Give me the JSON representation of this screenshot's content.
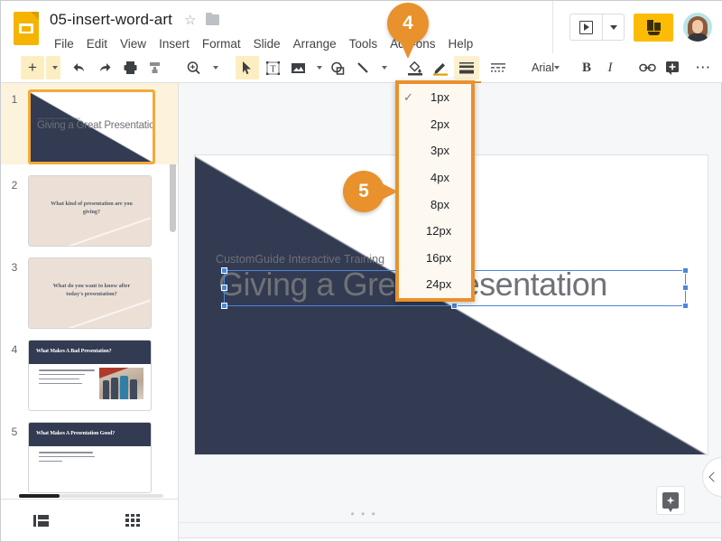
{
  "header": {
    "doc_title": "05-insert-word-art",
    "logo_icon": "google-slides-logo",
    "star_icon": "star-outline-icon",
    "folder_icon": "move-to-folder-icon",
    "menus": [
      "File",
      "Edit",
      "View",
      "Insert",
      "Format",
      "Slide",
      "Arrange",
      "Tools",
      "Add-ons",
      "Help"
    ],
    "present_label": "present-icon",
    "present_caret": "chevron-down-icon",
    "share_label": "share-icon",
    "avatar_label": "user-avatar"
  },
  "toolbar": {
    "items": [
      {
        "name": "new-slide-button",
        "icon": "plus-icon"
      },
      {
        "name": "new-slide-caret",
        "icon": "chevron-down-icon"
      },
      {
        "name": "undo-button",
        "icon": "undo-icon"
      },
      {
        "name": "redo-button",
        "icon": "redo-icon"
      },
      {
        "name": "print-button",
        "icon": "printer-icon"
      },
      {
        "name": "paint-format-button",
        "icon": "paint-roller-icon"
      },
      {
        "name": "zoom-button",
        "icon": "magnifier-icon"
      },
      {
        "name": "zoom-caret",
        "icon": "chevron-down-icon"
      },
      {
        "name": "select-tool",
        "icon": "cursor-arrow-icon"
      },
      {
        "name": "text-box-tool",
        "icon": "text-box-icon"
      },
      {
        "name": "image-tool",
        "icon": "image-icon"
      },
      {
        "name": "shape-tool",
        "icon": "shape-icon"
      },
      {
        "name": "line-tool",
        "icon": "line-icon"
      },
      {
        "name": "fill-color-button",
        "icon": "paint-bucket-icon"
      },
      {
        "name": "border-color-button",
        "icon": "pencil-icon"
      },
      {
        "name": "border-weight-button",
        "icon": "border-weight-icon"
      },
      {
        "name": "border-dash-button",
        "icon": "border-dash-icon"
      }
    ],
    "font_name": "Arial",
    "bold_label": "B",
    "italic_label": "I",
    "link_icon": "link-icon",
    "comment_icon": "add-comment-icon",
    "more_label": "⋯",
    "collapse_icon": "chevron-up-icon"
  },
  "border_weight_menu": {
    "options": [
      {
        "label": "1px",
        "checked": true
      },
      {
        "label": "2px",
        "checked": false
      },
      {
        "label": "3px",
        "checked": false
      },
      {
        "label": "4px",
        "checked": false
      },
      {
        "label": "8px",
        "checked": false
      },
      {
        "label": "12px",
        "checked": false
      },
      {
        "label": "16px",
        "checked": false
      },
      {
        "label": "24px",
        "checked": false
      }
    ],
    "check_glyph": "✓"
  },
  "slide_panel": {
    "slides": [
      {
        "number": "1",
        "title": "Giving a Great Presentation",
        "subtitle": "CustomGuide Interactive Training",
        "layout": "title-wedge",
        "selected": true
      },
      {
        "number": "2",
        "title": "What kind of presentation are you giving?",
        "layout": "question-beige",
        "selected": false
      },
      {
        "number": "3",
        "title": "What do you want to know after today's presentation?",
        "layout": "question-beige",
        "selected": false
      },
      {
        "number": "4",
        "title": "What Makes A Bad Presentation?",
        "layout": "bullets-photo",
        "selected": false
      },
      {
        "number": "5",
        "title": "What Makes A Presentation Good?",
        "layout": "bullets",
        "selected": false
      }
    ],
    "filmstrip_view_icon": "filmstrip-view-icon",
    "grid_view_icon": "grid-view-icon"
  },
  "slide_canvas": {
    "subtitle": "CustomGuide Interactive Training",
    "title": "Giving a Great Presentation",
    "shape_color": "#323b51",
    "selection_color": "#4b86db",
    "explore_icon": "explore-icon",
    "collapse_icon": "chevron-left-icon",
    "drag_dots": "• • •"
  },
  "callouts": [
    {
      "id": "4",
      "label": "4",
      "style": "pin"
    },
    {
      "id": "5",
      "label": "5",
      "style": "right-tail"
    }
  ],
  "colors": {
    "accent_orange": "#e8912d",
    "brand_yellow": "#fcbc05",
    "slide_navy": "#323b51",
    "selection_blue": "#4b86db",
    "highlight_yellow": "#fdeec2"
  }
}
